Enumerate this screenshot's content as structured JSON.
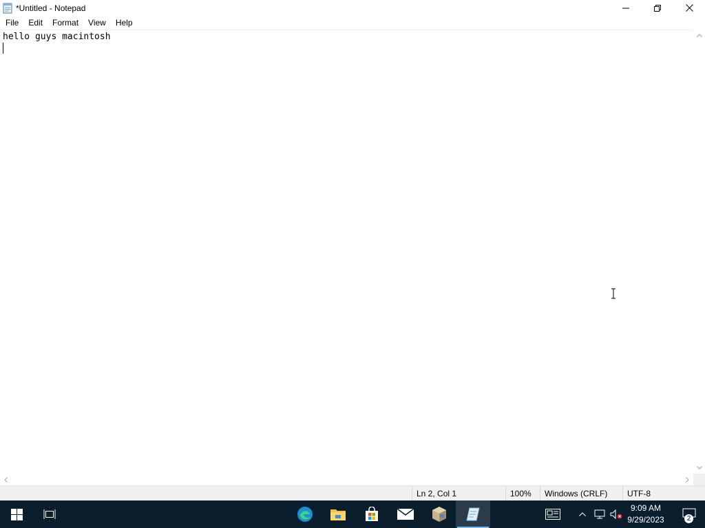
{
  "window": {
    "title": "*Untitled - Notepad",
    "app_icon": "notepad-icon",
    "controls": [
      "minimize-icon",
      "restore-icon",
      "close-icon"
    ]
  },
  "menu": {
    "items": [
      "File",
      "Edit",
      "Format",
      "View",
      "Help"
    ]
  },
  "editor": {
    "lines": [
      "hello guys macintosh",
      ""
    ]
  },
  "status": {
    "position": "Ln 2, Col 1",
    "zoom": "100%",
    "line_endings": "Windows (CRLF)",
    "encoding": "UTF-8"
  },
  "taskbar": {
    "apps": [
      "start-icon",
      "task-view-icon",
      "edge-icon",
      "file-explorer-icon",
      "store-icon",
      "mail-icon",
      "box-app-icon",
      "notepad-icon"
    ],
    "tray": [
      "news-icon",
      "chevron-up-icon",
      "network-icon",
      "volume-muted-icon"
    ],
    "clock_time": "9:09 AM",
    "clock_date": "9/29/2023",
    "notification_count": "2"
  },
  "colors": {
    "taskbar_bg": "#0a1e2e",
    "status_bg": "#f0f0f0",
    "taskbar_active_accent": "#76b9ed"
  }
}
